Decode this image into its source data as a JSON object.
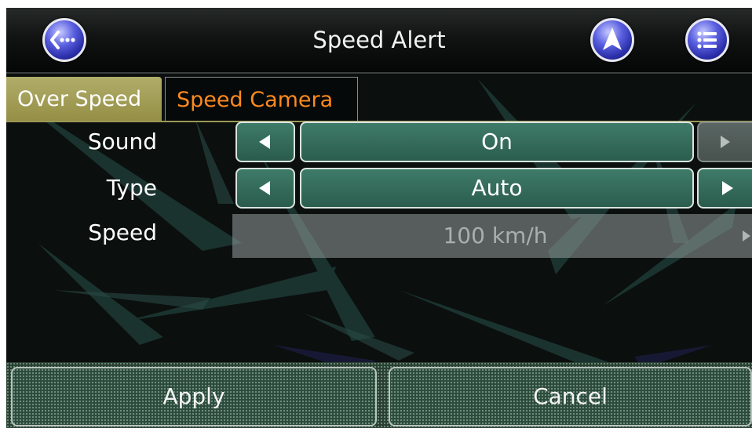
{
  "header": {
    "title": "Speed Alert",
    "icons": {
      "back": "back-ellipsis-icon",
      "navigate": "navigation-arrow-icon",
      "menu": "list-menu-icon"
    }
  },
  "tabs": [
    {
      "label": "Over Speed",
      "active": false
    },
    {
      "label": "Speed Camera",
      "active": true
    }
  ],
  "settings": {
    "sound": {
      "label": "Sound",
      "value": "On"
    },
    "type": {
      "label": "Type",
      "value": "Auto"
    },
    "speed": {
      "label": "Speed",
      "value": "100 km/h",
      "enabled": false
    }
  },
  "footer": {
    "apply_label": "Apply",
    "cancel_label": "Cancel"
  },
  "colors": {
    "accent_tab_active": "#ff8a1e",
    "tab_inactive": "#a6a25c",
    "control_green": "#3a7362",
    "button_blue": "#3a3fd0"
  }
}
